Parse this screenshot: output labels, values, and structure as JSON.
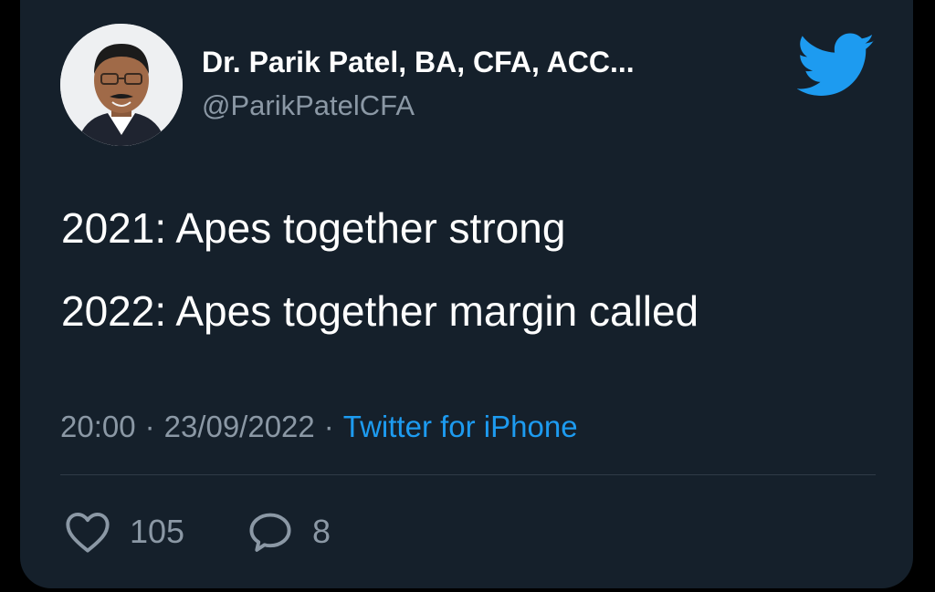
{
  "author": {
    "display_name": "Dr. Parik Patel, BA, CFA, ACC...",
    "handle": "@ParikPatelCFA"
  },
  "tweet": {
    "lines": [
      "2021: Apes together strong",
      "2022: Apes together margin called"
    ]
  },
  "meta": {
    "time": "20:00",
    "date": "23/09/2022",
    "separator": "·",
    "source": "Twitter for iPhone"
  },
  "actions": {
    "likes": "105",
    "replies": "8"
  },
  "icons": {
    "brand": "twitter-bird-icon",
    "like": "heart-icon",
    "reply": "speech-bubble-icon"
  },
  "colors": {
    "background": "#15202b",
    "text": "#ffffff",
    "muted": "#8b98a5",
    "accent": "#1d9bf0"
  }
}
